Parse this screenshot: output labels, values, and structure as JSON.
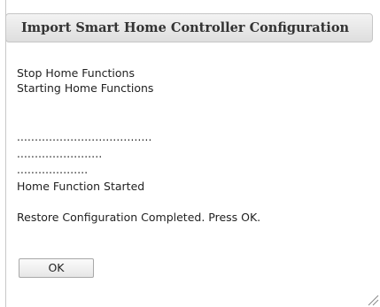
{
  "dialog": {
    "title": "Import Smart Home Controller Configuration",
    "lines": {
      "stop": "Stop Home Functions",
      "start": "Starting Home Functions",
      "dots1": "......................................",
      "dots2": "........................",
      "dots3": "....................",
      "started": "Home Function Started",
      "completed": "Restore Configuration Completed. Press OK."
    },
    "ok_label": "OK"
  }
}
